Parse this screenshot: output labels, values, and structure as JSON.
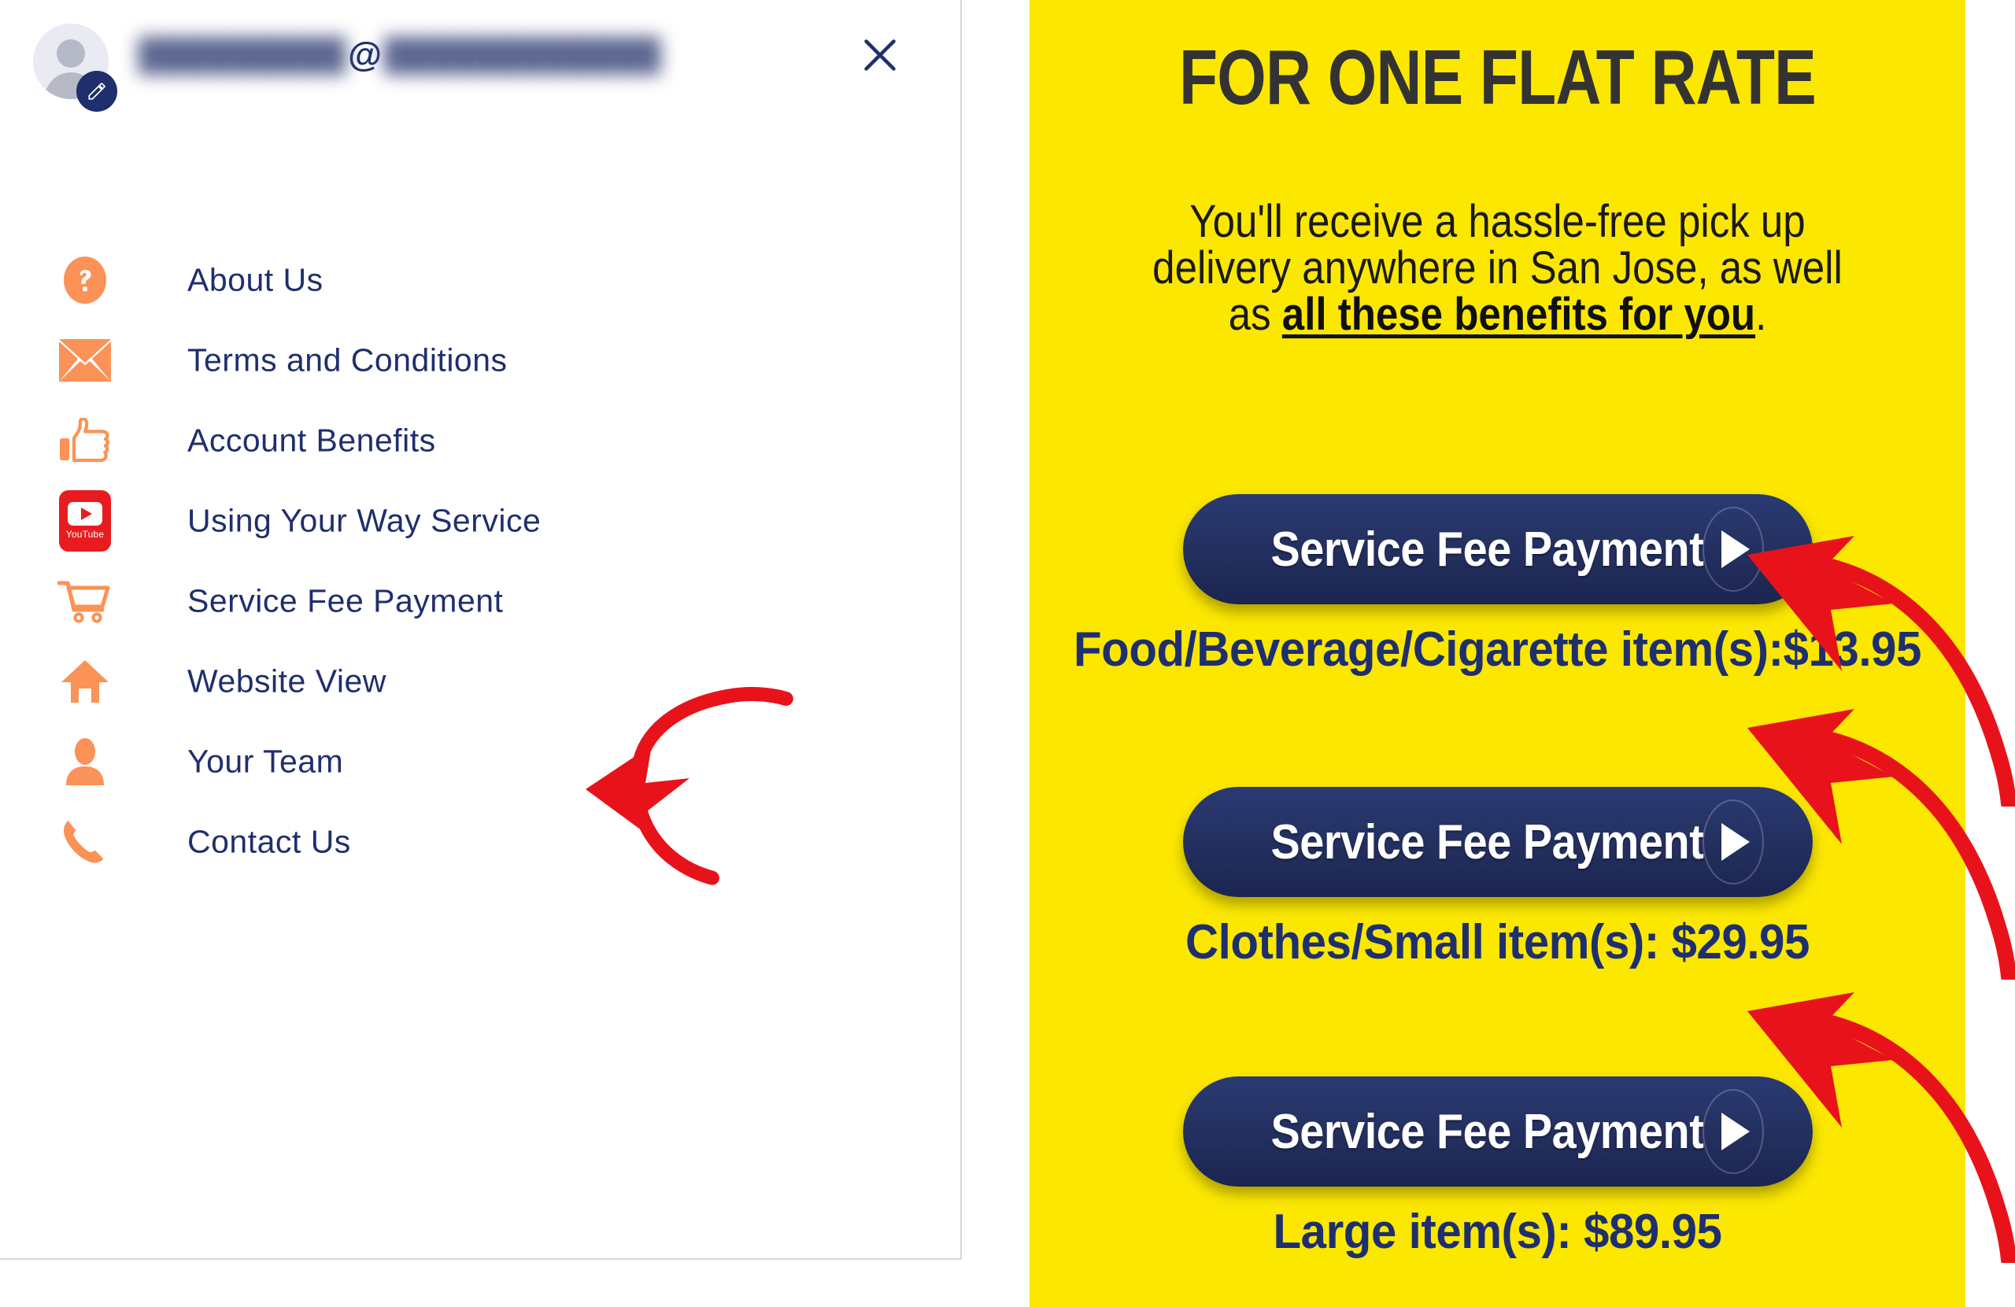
{
  "left_panel": {
    "account": {
      "email_masked": "█████████",
      "email_domain_masked": "████████████",
      "at_symbol": "@",
      "edit_icon": "pencil-edit-icon",
      "avatar_icon": "default-user-avatar-icon"
    },
    "close_label": "×",
    "close_icon": "close-x-icon",
    "menu": [
      {
        "label": "About Us",
        "icon": "question-mark-circle-icon"
      },
      {
        "label": "Terms and Conditions",
        "icon": "envelope-mail-icon"
      },
      {
        "label": "Account Benefits",
        "icon": "thumbs-up-icon"
      },
      {
        "label": "Using Your Way Service",
        "icon": "youtube-icon",
        "icon_caption": "YouTube"
      },
      {
        "label": "Service Fee Payment",
        "icon": "shopping-cart-icon",
        "highlighted": true
      },
      {
        "label": "Website View",
        "icon": "home-icon"
      },
      {
        "label": "Your Team",
        "icon": "person-icon"
      },
      {
        "label": "Contact Us",
        "icon": "phone-icon"
      }
    ],
    "annotation_arrow_icon": "red-curved-arrow-left-icon"
  },
  "right_panel": {
    "title": "FOR ONE FLAT RATE",
    "subtitle_line1": "You'll receive a hassle-free pick up",
    "subtitle_line2": "delivery anywhere in San Jose, as well",
    "subtitle_line3_prefix": "as ",
    "subtitle_line3_link": "all these benefits for you",
    "subtitle_line3_suffix": ".",
    "fees": [
      {
        "button_label": "Service Fee Payment",
        "caption": "Food/Beverage/Cigarette item(s):$13.95",
        "price": "$13.95",
        "category": "Food/Beverage/Cigarette item(s)"
      },
      {
        "button_label": "Service Fee Payment",
        "caption": "Clothes/Small item(s): $29.95",
        "price": "$29.95",
        "category": "Clothes/Small item(s)"
      },
      {
        "button_label": "Service Fee Payment",
        "caption": "Large item(s): $89.95",
        "price": "$89.95",
        "category": "Large item(s)"
      }
    ],
    "button_arrow_icon": "play-triangle-right-icon",
    "annotation_arrow_icon": "red-curved-arrow-up-left-icon"
  },
  "colors": {
    "panel_yellow": "#FBE700",
    "navy": "#1E2F6E",
    "button_navy": "#232F5E",
    "orange_icon": "#FB9257",
    "youtube_red": "#E81C20",
    "annotation_red": "#E8131A",
    "title_gray": "#333333",
    "avatar_gray": "#B6BAC6"
  }
}
